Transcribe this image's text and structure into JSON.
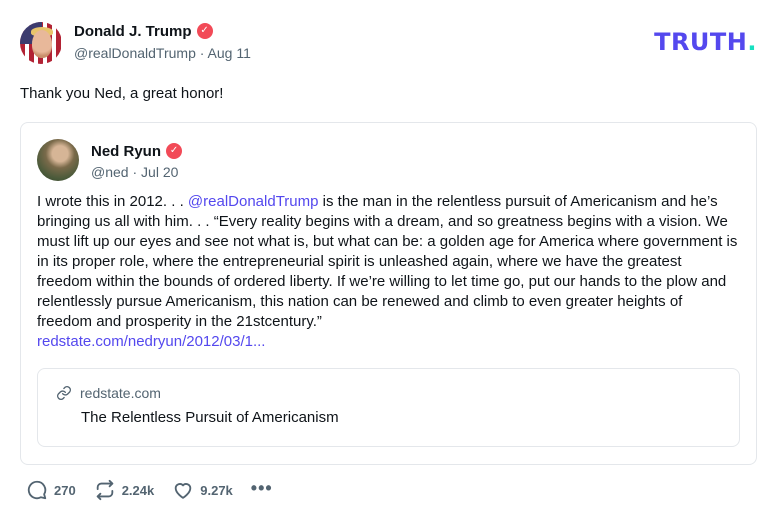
{
  "post": {
    "author_name": "Donald J. Trump",
    "handle": "@realDonaldTrump",
    "separator": "·",
    "date": "Aug 11",
    "text": "Thank you Ned, a great honor!"
  },
  "brand": {
    "logo_text": "TRUTH",
    "logo_dot": ".",
    "logo_color": "#5448ee",
    "dot_color": "#17e0c0"
  },
  "quoted": {
    "author_name": "Ned Ryun",
    "handle": "@ned",
    "separator": "·",
    "date": "Jul 20",
    "text_before": "I wrote this in 2012. . . ",
    "mention": "@realDonaldTrump",
    "text_after": " is the man in the relentless pursuit of Americanism and he’s bringing us all with him. . . “Every reality begins with a dream, and so greatness begins with a vision. We must lift up our eyes and see not what is, but what can be: a golden age for America where government is in its proper role, where the entrepreneurial spirit is unleashed again, where we have the greatest freedom within the bounds of ordered liberty. If we’re willing to let time go, put our hands to the plow and relentlessly pursue Americanism, this nation can be renewed and climb to even greater heights of freedom and prosperity in the 21stcentury.”",
    "link_text": "redstate.com/nedryun/2012/03/1...",
    "card": {
      "domain": "redstate.com",
      "title": "The Relentless Pursuit of Americanism"
    }
  },
  "actions": {
    "replies": "270",
    "retruths": "2.24k",
    "likes": "9.27k",
    "more_label": "•••"
  },
  "icons": [
    "verified-badge-icon",
    "link-icon",
    "reply-icon",
    "retruth-icon",
    "like-icon",
    "more-icon"
  ]
}
